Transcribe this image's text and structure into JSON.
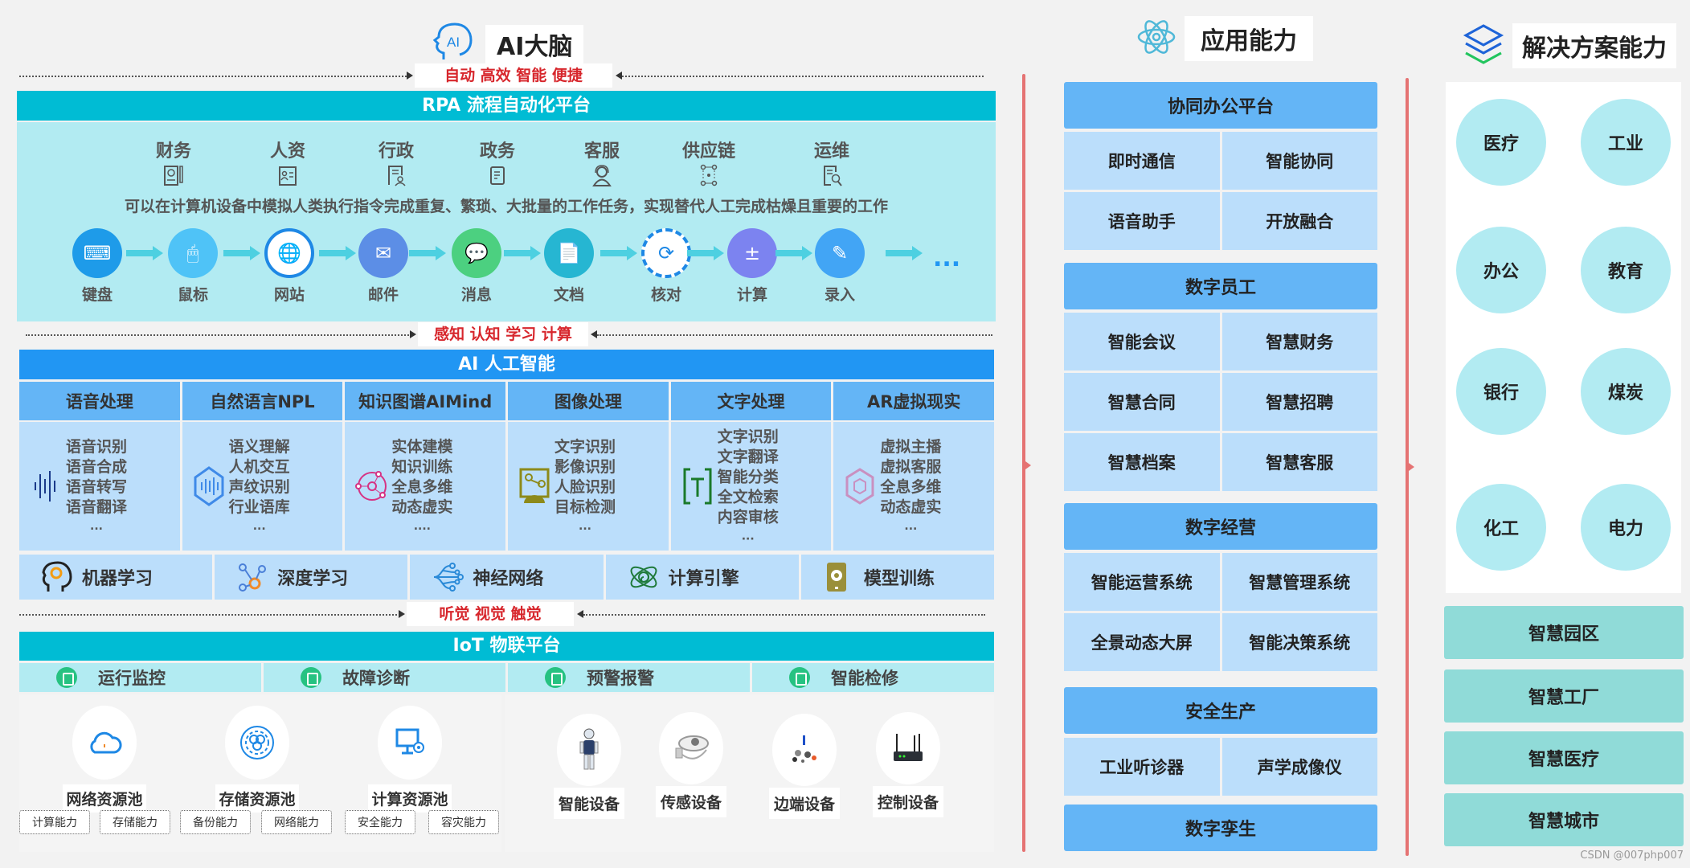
{
  "ai_brain": {
    "title": "AI大脑",
    "icon": "ai-head-icon",
    "tagline_top": "自动 高效 智能 便捷",
    "tagline_mid": "感知 认知 学习 计算",
    "tagline_bottom": "听觉 视觉 触觉",
    "rpa": {
      "title": "RPA 流程自动化平台",
      "departments": [
        {
          "label": "财务",
          "icon": "finance-doc-icon"
        },
        {
          "label": "人资",
          "icon": "id-card-icon"
        },
        {
          "label": "行政",
          "icon": "admin-doc-icon"
        },
        {
          "label": "政务",
          "icon": "document-icon"
        },
        {
          "label": "客服",
          "icon": "headset-agent-icon"
        },
        {
          "label": "供应链",
          "icon": "supply-chain-icon"
        },
        {
          "label": "运维",
          "icon": "maintenance-doc-icon"
        }
      ],
      "description": "可以在计算机设备中模拟人类执行指令完成重复、繁琐、大批量的工作任务，实现替代人工完成枯燥且重要的工作",
      "flow": [
        {
          "label": "键盘",
          "icon": "keyboard-icon",
          "color": "#1e9be9"
        },
        {
          "label": "鼠标",
          "icon": "mouse-icon",
          "color": "#4fc3f7"
        },
        {
          "label": "网站",
          "icon": "globe-icon",
          "color": "#1e88e5"
        },
        {
          "label": "邮件",
          "icon": "mail-icon",
          "color": "#5c8ee6"
        },
        {
          "label": "消息",
          "icon": "message-icon",
          "color": "#4cd080"
        },
        {
          "label": "文档",
          "icon": "document-icon",
          "color": "#26b6d2"
        },
        {
          "label": "核对",
          "icon": "stamp-icon",
          "color": "#1e88e5"
        },
        {
          "label": "计算",
          "icon": "calculator-icon",
          "color": "#7c83f0"
        },
        {
          "label": "录入",
          "icon": "input-edit-icon",
          "color": "#42a5f5"
        }
      ],
      "flow_more": "..."
    },
    "ai": {
      "title": "AI 人工智能",
      "columns": [
        {
          "title": "语音处理",
          "icon": "sound-wave-icon",
          "items": [
            "语音识别",
            "语音合成",
            "语音转写",
            "语音翻译"
          ],
          "more": "..."
        },
        {
          "title": "自然语言NPL",
          "icon": "nlp-network-icon",
          "items": [
            "语义理解",
            "人机交互",
            "声纹识别",
            "行业语库"
          ],
          "more": "..."
        },
        {
          "title": "知识图谱AIMind",
          "icon": "knowledge-graph-icon",
          "items": [
            "实体建模",
            "知识训练",
            "全息多维",
            "动态虚实"
          ],
          "more": "...."
        },
        {
          "title": "图像处理",
          "icon": "image-graph-icon",
          "items": [
            "文字识别",
            "影像识别",
            "人脸识别",
            "目标检测"
          ],
          "more": "..."
        },
        {
          "title": "文字处理",
          "icon": "text-scan-icon",
          "items": [
            "文字识别",
            "文字翻译",
            "智能分类",
            "全文检索",
            "内容审核"
          ],
          "more": "..."
        },
        {
          "title": "AR虚拟现实",
          "icon": "ar-hexagon-icon",
          "items": [
            "虚拟主播",
            "虚拟客服",
            "全息多维",
            "动态虚实"
          ],
          "more": "..."
        }
      ],
      "foundations": [
        {
          "label": "机器学习",
          "icon": "brain-head-icon"
        },
        {
          "label": "深度学习",
          "icon": "molecule-icon"
        },
        {
          "label": "神经网络",
          "icon": "neural-network-icon"
        },
        {
          "label": "计算引擎",
          "icon": "atom-orbit-icon"
        },
        {
          "label": "模型训练",
          "icon": "phone-eye-icon"
        }
      ]
    },
    "iot": {
      "title": "IoT 物联平台",
      "functions": [
        {
          "label": "运行监控",
          "icon": "monitor-gear-icon"
        },
        {
          "label": "故障诊断",
          "icon": "diagnosis-icon"
        },
        {
          "label": "预警报警",
          "icon": "alert-doc-icon"
        },
        {
          "label": "智能检修",
          "icon": "repair-doc-icon"
        }
      ],
      "pools": [
        {
          "label": "网络资源池",
          "icon": "cloud-icon"
        },
        {
          "label": "存储资源池",
          "icon": "storage-orbit-icon"
        },
        {
          "label": "计算资源池",
          "icon": "computer-gear-icon"
        }
      ],
      "capabilities": [
        "计算能力",
        "存储能力",
        "备份能力",
        "网络能力",
        "安全能力",
        "容灾能力"
      ],
      "devices": [
        {
          "label": "智能设备",
          "icon": "robot-icon"
        },
        {
          "label": "传感设备",
          "icon": "sensor-icon"
        },
        {
          "label": "边端设备",
          "icon": "edge-device-icon"
        },
        {
          "label": "控制设备",
          "icon": "router-icon"
        }
      ]
    }
  },
  "application": {
    "title": "应用能力",
    "icon": "atom-icon",
    "groups": [
      {
        "title": "协同办公平台",
        "items": [
          "即时通信",
          "智能协同",
          "语音助手",
          "开放融合"
        ]
      },
      {
        "title": "数字员工",
        "items": [
          "智能会议",
          "智慧财务",
          "智慧合同",
          "智慧招聘",
          "智慧档案",
          "智慧客服"
        ]
      },
      {
        "title": "数字经营",
        "items": [
          "智能运营系统",
          "智慧管理系统",
          "全景动态大屏",
          "智能决策系统"
        ]
      },
      {
        "title": "安全生产",
        "items": [
          "工业听诊器",
          "声学成像仪"
        ]
      },
      {
        "title": "数字孪生",
        "items": []
      }
    ]
  },
  "solutions": {
    "title": "解决方案能力",
    "icon": "layers-icon",
    "industries": [
      "医疗",
      "工业",
      "办公",
      "教育",
      "银行",
      "煤炭",
      "化工",
      "电力"
    ],
    "smart": [
      "智慧园区",
      "智慧工厂",
      "智慧医疗",
      "智慧城市"
    ]
  },
  "watermark": "CSDN @007php007",
  "colors": {
    "rpa_band": "#00bcd4",
    "ai_band": "#2196f3",
    "tag_red": "#d7262c",
    "divider": "#e57373",
    "mid_head": "#64b5f6",
    "mid_cell": "#bbdefb",
    "industry_circle": "#b2ebf2",
    "smart_box": "#90dbd8"
  }
}
